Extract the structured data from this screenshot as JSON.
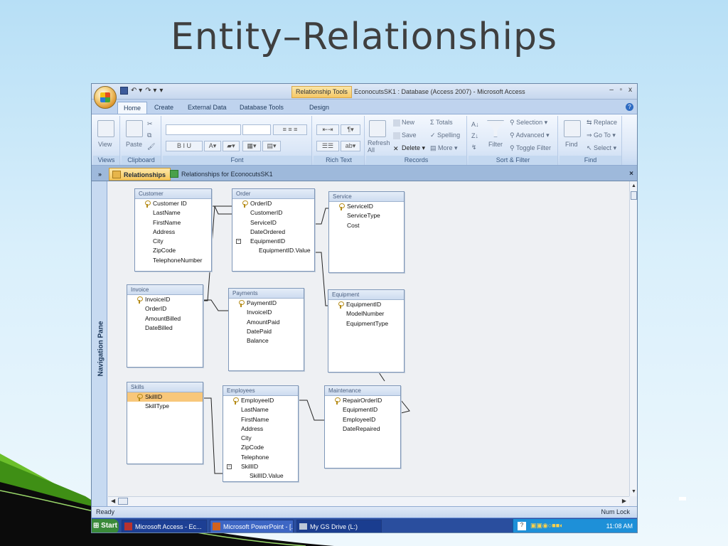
{
  "slide": {
    "title": "Entity–Relationships"
  },
  "window": {
    "context_tab": "Relationship Tools",
    "title": "EconocutsSK1 : Database (Access 2007) - Microsoft Access",
    "controls": "– ▫ x"
  },
  "ribbon_tabs": [
    "Home",
    "Create",
    "External Data",
    "Database Tools",
    "Design"
  ],
  "ribbon": {
    "views": {
      "label": "Views",
      "button": "View"
    },
    "clipboard": {
      "label": "Clipboard",
      "button": "Paste"
    },
    "font": {
      "label": "Font"
    },
    "rich_text": {
      "label": "Rich Text"
    },
    "records": {
      "label": "Records",
      "refresh": "Refresh\nAll",
      "new": "New",
      "save": "Save",
      "delete": "Delete",
      "totals": "Totals",
      "spelling": "Spelling",
      "more": "More"
    },
    "sort_filter": {
      "label": "Sort & Filter",
      "filter": "Filter",
      "selection": "Selection",
      "advanced": "Advanced",
      "toggle": "Toggle Filter"
    },
    "find": {
      "label": "Find",
      "find": "Find",
      "replace": "Replace",
      "goto": "Go To",
      "select": "Select"
    }
  },
  "doc_tabs": {
    "chevron": "»",
    "relationships": "Relationships",
    "relationships_for": "Relationships for EconocutsSK1",
    "close": "×"
  },
  "nav_pane": {
    "label": "Navigation Pane"
  },
  "tables": {
    "customer": {
      "title": "Customer",
      "fields": [
        "Customer ID",
        "LastName",
        "FirstName",
        "Address",
        "City",
        "ZipCode",
        "TelephoneNumber"
      ],
      "key": 0
    },
    "order": {
      "title": "Order",
      "fields": [
        "OrderID",
        "CustomerID",
        "ServiceID",
        "DateOrdered",
        "EquipmentID",
        "EquipmentID.Value"
      ],
      "key": 0
    },
    "service": {
      "title": "Service",
      "fields": [
        "ServiceID",
        "ServiceType",
        "Cost"
      ],
      "key": 0
    },
    "invoice": {
      "title": "Invoice",
      "fields": [
        "InvoiceID",
        "OrderID",
        "AmountBilled",
        "DateBilled"
      ],
      "key": 0
    },
    "payments": {
      "title": "Payments",
      "fields": [
        "PaymentID",
        "InvoiceID",
        "AmountPaid",
        "DatePaid",
        "Balance"
      ],
      "key": 0
    },
    "equipment": {
      "title": "Equipment",
      "fields": [
        "EquipmentID",
        "ModelNumber",
        "EquipmentType"
      ],
      "key": 0
    },
    "skills": {
      "title": "Skills",
      "fields": [
        "SkillID",
        "SkillType"
      ],
      "key": 0
    },
    "employees": {
      "title": "Employees",
      "fields": [
        "EmployeeID",
        "LastName",
        "FirstName",
        "Address",
        "City",
        "ZipCode",
        "Telephone",
        "SkillID",
        "SkillID.Value"
      ],
      "key": 0
    },
    "maintenance": {
      "title": "Maintenance",
      "fields": [
        "RepairOrderID",
        "EquipmentID",
        "EmployeeID",
        "DateRepaired"
      ],
      "key": 0
    }
  },
  "status": {
    "left": "Ready",
    "right": "Num Lock"
  },
  "taskbar": {
    "start": "Start",
    "tasks": [
      "Microsoft Access - Ec...",
      "Microsoft PowerPoint - [...",
      "My GS Drive (L:)"
    ],
    "clock": "11:08 AM"
  }
}
